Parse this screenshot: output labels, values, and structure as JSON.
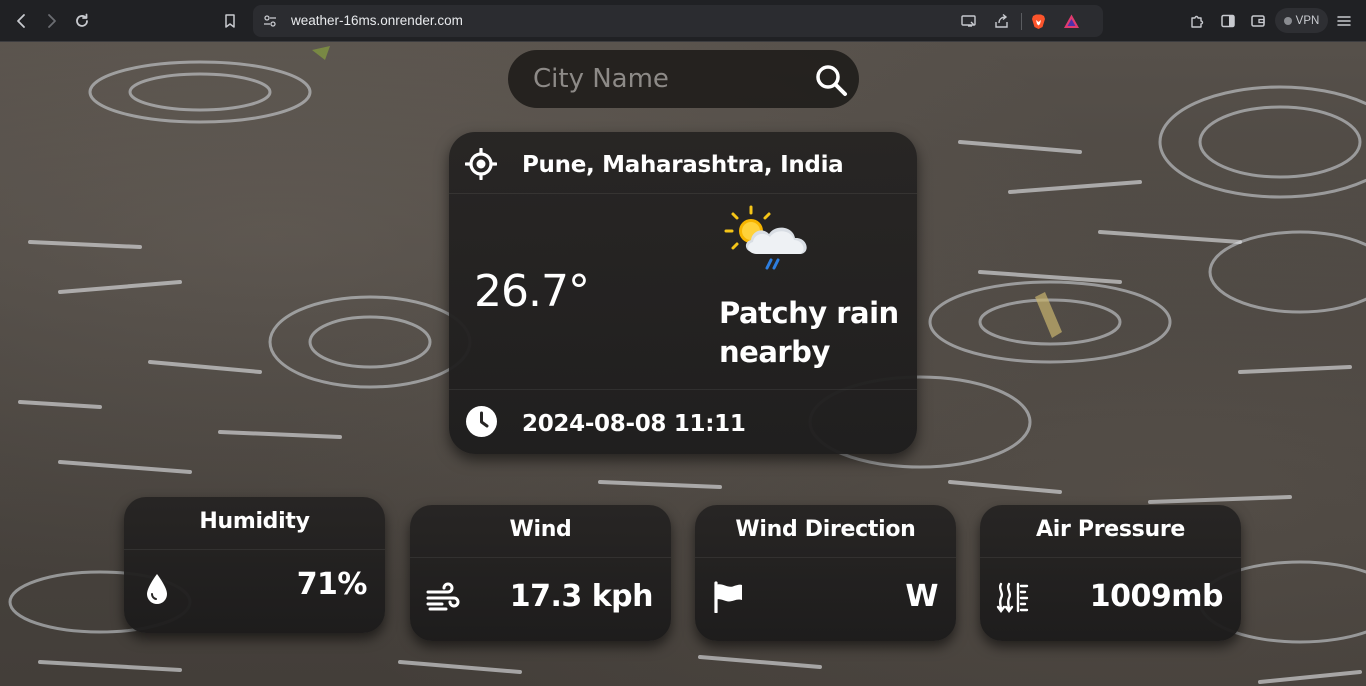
{
  "browser": {
    "url": "weather-16ms.onrender.com",
    "vpn_label": "VPN"
  },
  "search": {
    "placeholder": "City Name"
  },
  "current": {
    "location": "Pune, Maharashtra, India",
    "temperature": "26.7°",
    "condition": "Patchy rain nearby",
    "condition_icon": "partly-cloudy-rain-icon",
    "datetime": "2024-08-08 11:11"
  },
  "stats": {
    "humidity": {
      "title": "Humidity",
      "value": "71%",
      "icon": "droplet-icon"
    },
    "wind": {
      "title": "Wind",
      "value": "17.3 kph",
      "icon": "wind-icon"
    },
    "wind_direction": {
      "title": "Wind Direction",
      "value": "W",
      "icon": "flag-icon"
    },
    "air_pressure": {
      "title": "Air Pressure",
      "value": "1009mb",
      "icon": "pressure-icon"
    }
  }
}
